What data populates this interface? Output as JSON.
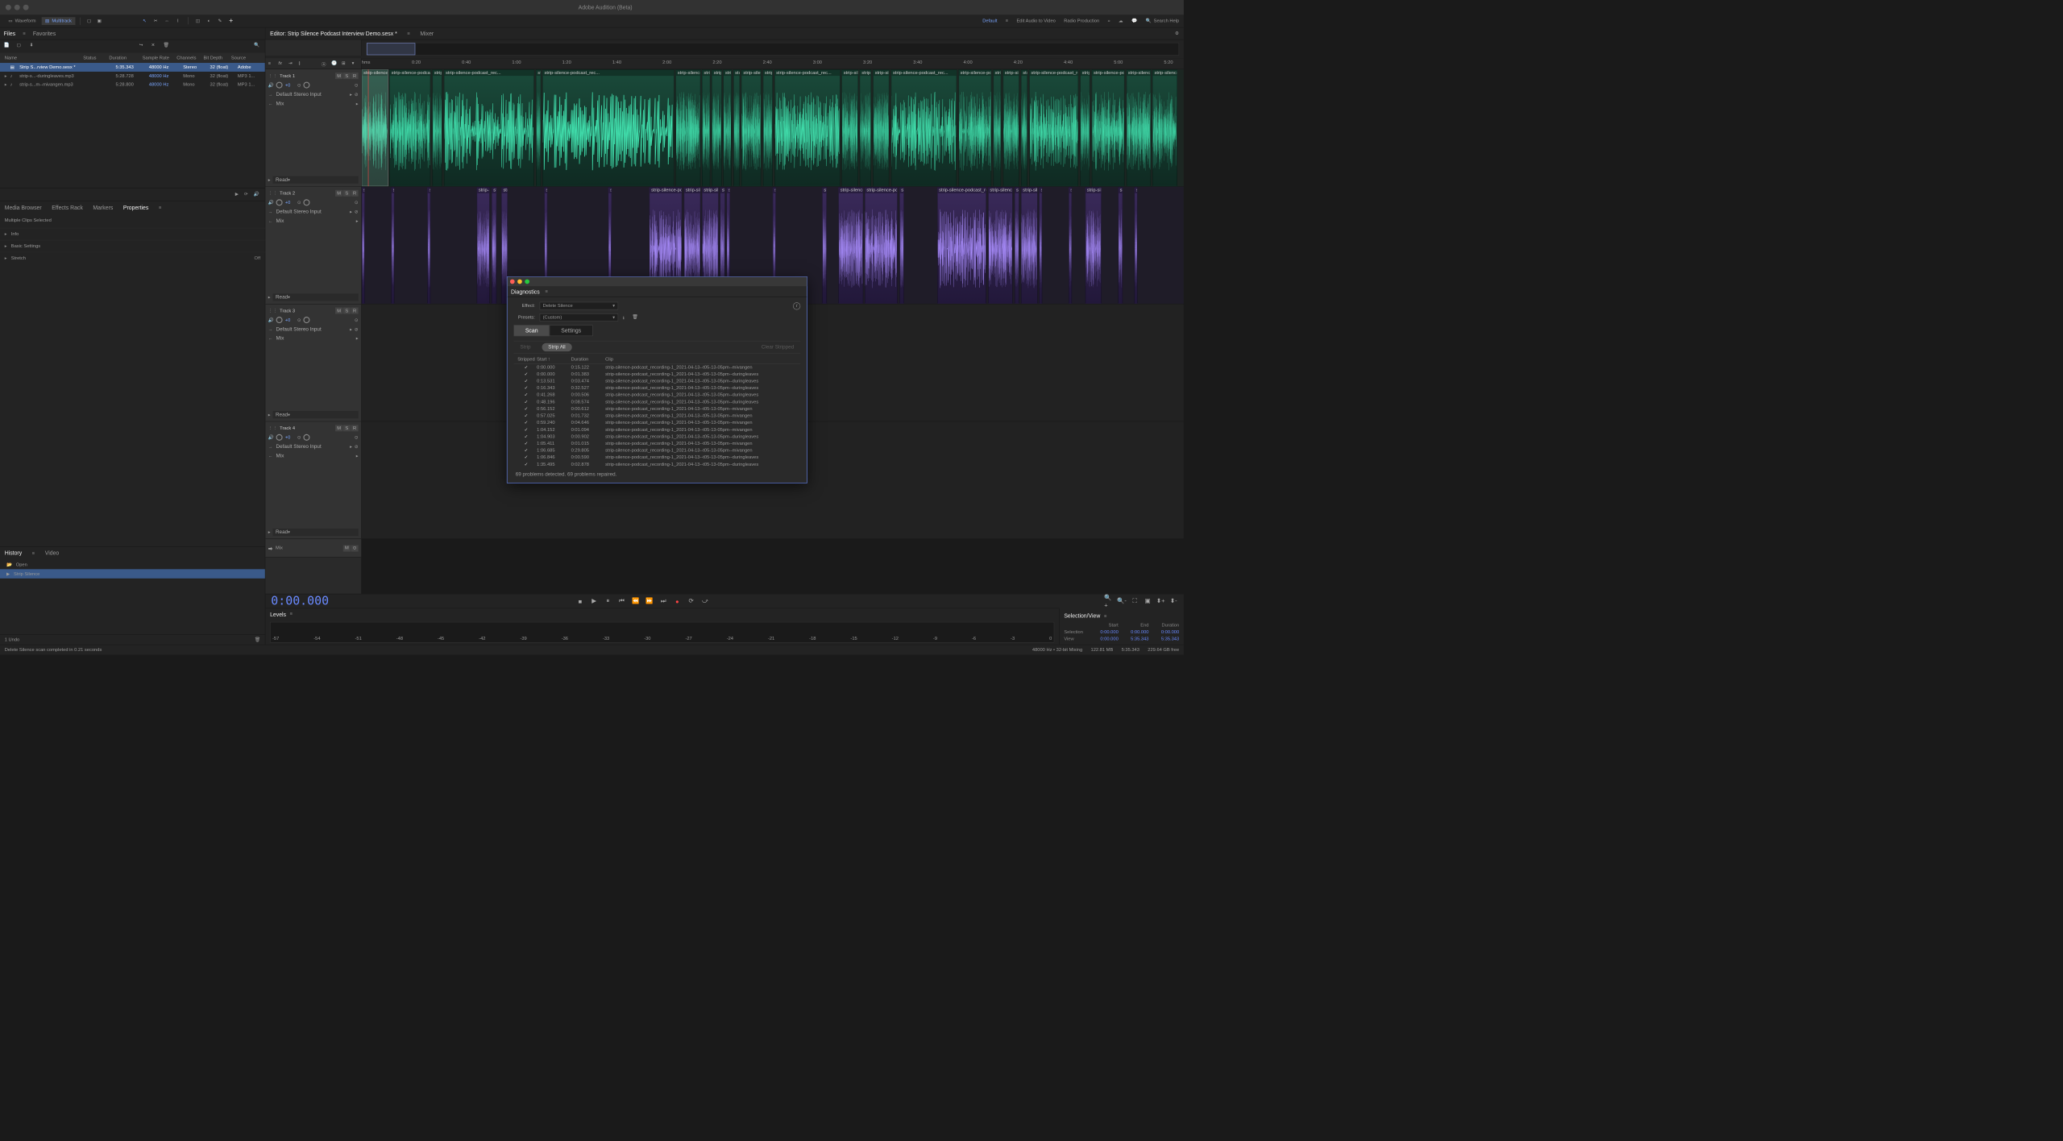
{
  "app_title": "Adobe Audition (Beta)",
  "view_modes": {
    "waveform": "Waveform",
    "multitrack": "Multitrack"
  },
  "workspaces": {
    "default": "Default",
    "edit_av": "Edit Audio to Video",
    "radio": "Radio Production"
  },
  "search_placeholder": "Search Help",
  "files_panel": {
    "tab": "Files",
    "favorites": "Favorites",
    "headers": {
      "name": "Name",
      "status": "Status",
      "duration": "Duration",
      "sample_rate": "Sample Rate",
      "channels": "Channels",
      "bit_depth": "Bit Depth",
      "source": "Source"
    },
    "rows": [
      {
        "name": "Strip S...rview Demo.sesx *",
        "status": "",
        "duration": "5:35.343",
        "sr": "48000 Hz",
        "ch": "Stereo",
        "bd": "32 (float)",
        "src": "Adobe"
      },
      {
        "name": "strip-s...-duringleaves.mp3",
        "status": "",
        "duration": "5:28.728",
        "sr": "48000 Hz",
        "ch": "Mono",
        "bd": "32 (float)",
        "src": "MP3 1..."
      },
      {
        "name": "strip-s...m--mivangen.mp3",
        "status": "",
        "duration": "5:28.800",
        "sr": "48000 Hz",
        "ch": "Mono",
        "bd": "32 (float)",
        "src": "MP3 1..."
      }
    ]
  },
  "props_panel": {
    "tabs": {
      "media": "Media Browser",
      "fx": "Effects Rack",
      "markers": "Markers",
      "properties": "Properties"
    },
    "subtitle": "Multiple Clips Selected",
    "sections": {
      "info": "Info",
      "basic": "Basic Settings",
      "stretch": "Stretch",
      "stretch_val": "Off"
    }
  },
  "history": {
    "tabs": {
      "history": "History",
      "video": "Video"
    },
    "items": [
      {
        "label": "Open"
      },
      {
        "label": "Strip Silence"
      }
    ]
  },
  "editor": {
    "tab": "Editor: Strip Silence Podcast Interview Demo.sesx *",
    "mixer": "Mixer"
  },
  "ruler_ticks": [
    "hms",
    "0:20",
    "0:40",
    "1:00",
    "1:20",
    "1:40",
    "2:00",
    "2:20",
    "2:40",
    "3:00",
    "3:20",
    "3:40",
    "4:00",
    "4:20",
    "4:40",
    "5:00",
    "5:20"
  ],
  "tracks": [
    {
      "name": "Track 1",
      "vol": "+0",
      "input": "Default Stereo Input",
      "mix": "Mix",
      "read": "Read"
    },
    {
      "name": "Track 2",
      "vol": "+0",
      "input": "Default Stereo Input",
      "mix": "Mix",
      "read": "Read"
    },
    {
      "name": "Track 3",
      "vol": "+0",
      "input": "Default Stereo Input",
      "mix": "Mix",
      "read": "Read"
    },
    {
      "name": "Track 4",
      "vol": "+0",
      "input": "Default Stereo Input",
      "mix": "Mix",
      "read": "Read"
    }
  ],
  "mix_track": "Mix",
  "clip_labels": {
    "green": "strip-silence-podcast_rec...",
    "purple": "strip-silence-podcast_rec..."
  },
  "timecode": "0:00.000",
  "levels_tab": "Levels",
  "db_ticks": [
    "-57",
    "-54",
    "-51",
    "-48",
    "-45",
    "-42",
    "-39",
    "-36",
    "-33",
    "-30",
    "-27",
    "-24",
    "-21",
    "-18",
    "-15",
    "-12",
    "-9",
    "-6",
    "-3",
    "0"
  ],
  "selview": {
    "title": "Selection/View",
    "headers": {
      "start": "Start",
      "end": "End",
      "duration": "Duration"
    },
    "selection": {
      "label": "Selection",
      "start": "0:00.000",
      "end": "0:00.000",
      "dur": "0:00.000"
    },
    "view": {
      "label": "View",
      "start": "0:00.000",
      "end": "5:35.343",
      "dur": "5:35.343"
    }
  },
  "undo_text": "1 Undo",
  "status_msg": "Delete Silence scan completed in 0.21 seconds",
  "status_right": {
    "format": "48000 Hz • 32-bit Mixing",
    "mem": "122.81 MB",
    "dur": "5:35.343",
    "free": "229.64 GB free"
  },
  "dialog": {
    "tab": "Diagnostics",
    "effect_lbl": "Effect:",
    "effect_val": "Delete Silence",
    "presets_lbl": "Presets:",
    "presets_val": "(Custom)",
    "scan": "Scan",
    "settings": "Settings",
    "strip": "Strip",
    "strip_all": "Strip All",
    "clear": "Clear Stripped",
    "cols": {
      "stripped": "Stripped",
      "start": "Start ↑",
      "duration": "Duration",
      "clip": "Clip"
    },
    "rows": [
      {
        "start": "0:00.000",
        "dur": "0:15.122",
        "clip": "strip-silence-podcast_recording-1_2021-04-13--t05-13-05pm--mivangen"
      },
      {
        "start": "0:00.000",
        "dur": "0:01.383",
        "clip": "strip-silence-podcast_recording-1_2021-04-13--t05-13-05pm--duringleaves"
      },
      {
        "start": "0:13.531",
        "dur": "0:03.474",
        "clip": "strip-silence-podcast_recording-1_2021-04-13--t05-13-05pm--duringleaves"
      },
      {
        "start": "0:16.343",
        "dur": "0:32.527",
        "clip": "strip-silence-podcast_recording-1_2021-04-13--t05-13-05pm--duringleaves"
      },
      {
        "start": "0:41.268",
        "dur": "0:00.506",
        "clip": "strip-silence-podcast_recording-1_2021-04-13--t05-13-05pm--duringleaves"
      },
      {
        "start": "0:48.196",
        "dur": "0:08.574",
        "clip": "strip-silence-podcast_recording-1_2021-04-13--t05-13-05pm--duringleaves"
      },
      {
        "start": "0:56.152",
        "dur": "0:00.612",
        "clip": "strip-silence-podcast_recording-1_2021-04-13--t05-13-05pm--mivangen"
      },
      {
        "start": "0:57.025",
        "dur": "0:01.732",
        "clip": "strip-silence-podcast_recording-1_2021-04-13--t05-13-05pm--mivangen"
      },
      {
        "start": "0:59.240",
        "dur": "0:04.646",
        "clip": "strip-silence-podcast_recording-1_2021-04-13--t05-13-05pm--mivangen"
      },
      {
        "start": "1:04.152",
        "dur": "0:01.094",
        "clip": "strip-silence-podcast_recording-1_2021-04-13--t05-13-05pm--mivangen"
      },
      {
        "start": "1:04.903",
        "dur": "0:00.902",
        "clip": "strip-silence-podcast_recording-1_2021-04-13--t05-13-05pm--duringleaves"
      },
      {
        "start": "1:05.411",
        "dur": "0:01.015",
        "clip": "strip-silence-podcast_recording-1_2021-04-13--t05-13-05pm--mivangen"
      },
      {
        "start": "1:06.685",
        "dur": "0:29.805",
        "clip": "strip-silence-podcast_recording-1_2021-04-13--t05-13-05pm--mivangen"
      },
      {
        "start": "1:06.846",
        "dur": "0:00.590",
        "clip": "strip-silence-podcast_recording-1_2021-04-13--t05-13-05pm--duringleaves"
      },
      {
        "start": "1:35.495",
        "dur": "0:02.878",
        "clip": "strip-silence-podcast_recording-1_2021-04-13--t05-13-05pm--duringleaves"
      }
    ],
    "status": "69 problems detected. 69 problems repaired."
  }
}
